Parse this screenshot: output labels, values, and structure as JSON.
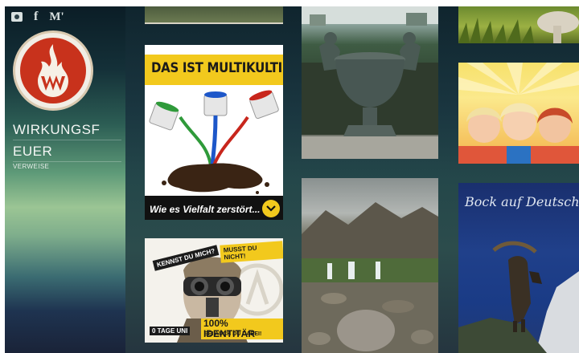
{
  "sidebar": {
    "social": {
      "rss_icon": "rss-icon",
      "facebook_label": "f",
      "medium_label": "M'"
    },
    "logo": {
      "icon": "flame-w-logo-icon",
      "colors": {
        "ring": "#f1ede5",
        "disc": "#c8321c",
        "flame": "#f6f0e6"
      }
    },
    "title_line1": "WIRKUNGSF",
    "title_line2": "EUER",
    "subtitle": "VERWEISE"
  },
  "tiles": {
    "multikulti": {
      "headline": "DAS IST MULTIKULTI",
      "caption": "Wie es Vielfalt zerstört...",
      "accent": "#f2c91d"
    },
    "identitaer": {
      "tag_left": "KENNST DU MICH?",
      "tag_right": "MUSST DU NICHT!",
      "tag_bottom_left": "0 TAGE UNI",
      "headline": "100% IDENTITÄR",
      "subline": "SEI AUCH DU DABEI!"
    },
    "bock": {
      "title": "Bock auf Deutschla"
    }
  }
}
